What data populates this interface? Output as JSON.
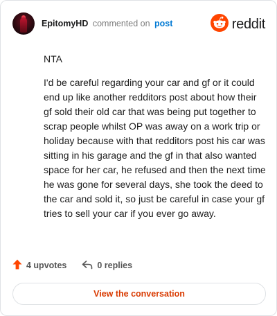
{
  "header": {
    "username": "EpitomyHD",
    "action": "commented on",
    "post_link": "post",
    "logo_text": "reddit"
  },
  "comment": {
    "paragraphs": [
      "NTA",
      "I'd be careful regarding your car and gf or it could end up like another redditors post about how their gf sold their old car that was being put together to scrap people whilst OP was away on a work trip or holiday because with that redditors post his car was sitting in his garage and the gf in that also wanted space for her car, he refused and then the next time he was gone for several days, she took the deed to the car and sold it, so just be careful in case your gf tries to sell your car if you ever go away."
    ]
  },
  "footer": {
    "upvotes": "4 upvotes",
    "replies": "0 replies",
    "view_button": "View the conversation"
  },
  "colors": {
    "accent": "#d93a00",
    "reddit_orange": "#ff4500",
    "link": "#0079d3"
  },
  "icons": {
    "upvote": "upvote-arrow-icon",
    "reply": "reply-arrow-icon",
    "logo": "reddit-snoo-icon"
  }
}
